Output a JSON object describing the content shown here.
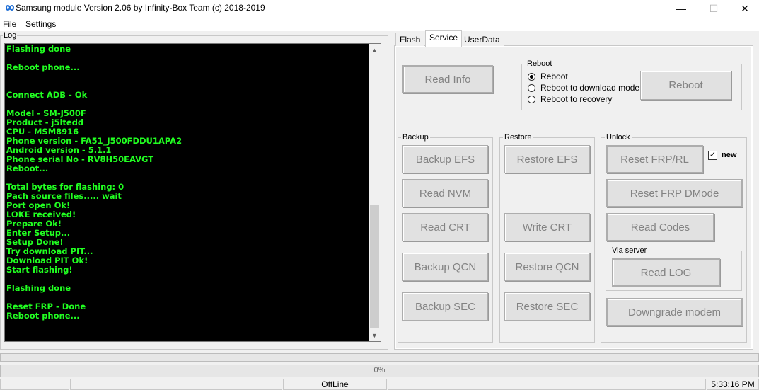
{
  "window": {
    "title": "Samsung module  Version 2.06 by Infinity-Box Team (c) 2018-2019",
    "min_glyph": "—",
    "max_glyph": "☐",
    "close_glyph": "✕"
  },
  "menu": [
    "File",
    "Settings"
  ],
  "log": {
    "label": "Log",
    "lines": [
      "Flashing done",
      "",
      "Reboot phone...",
      "",
      "",
      "Connect ADB - Ok",
      "",
      "Model - SM-J500F",
      "Product - j5ltedd",
      "CPU - MSM8916",
      "Phone version - FA51_J500FDDU1APA2",
      "Android version - 5.1.1",
      "Phone serial No - RV8H50EAVGT",
      "Reboot...",
      "",
      "Total bytes for flashing: 0",
      "Pach source files..... wait",
      "Port open Ok!",
      "LOKE received!",
      "Prepare Ok!",
      "Enter Setup...",
      "Setup Done!",
      "Try download PIT...",
      "Download PIT Ok!",
      "Start flashing!",
      "",
      "Flashing done",
      "",
      "Reset FRP - Done",
      "Reboot phone..."
    ]
  },
  "tabs": [
    "Flash",
    "Service",
    "UserData"
  ],
  "service": {
    "read_info": "Read Info",
    "reboot_group": {
      "label": "Reboot",
      "options": [
        "Reboot",
        "Reboot to download mode",
        "Reboot to recovery"
      ],
      "selected": "Reboot",
      "button": "Reboot"
    },
    "backup": {
      "label": "Backup",
      "buttons": [
        "Backup EFS",
        "Read  NVM",
        "Read CRT",
        "Backup QCN",
        "Backup SEC"
      ]
    },
    "restore": {
      "label": "Restore",
      "buttons": [
        "Restore EFS",
        "Write CRT",
        "Restore QCN",
        "Restore SEC"
      ]
    },
    "unlock": {
      "label": "Unlock",
      "reset_frp_rl": "Reset FRP/RL",
      "new_label": "new",
      "new_checked": true,
      "reset_frp_dmode": "Reset FRP DMode",
      "read_codes": "Read Codes",
      "via_server_label": "Via server",
      "read_log": "Read LOG",
      "downgrade_modem": "Downgrade modem"
    }
  },
  "progress": {
    "percent_text": "0%",
    "value": 0
  },
  "status": {
    "connection": "OffLine",
    "time": "5:33:16 PM"
  },
  "colors": {
    "log_text": "#21ff21",
    "log_bg": "#000000",
    "disabled_text": "#838383"
  }
}
